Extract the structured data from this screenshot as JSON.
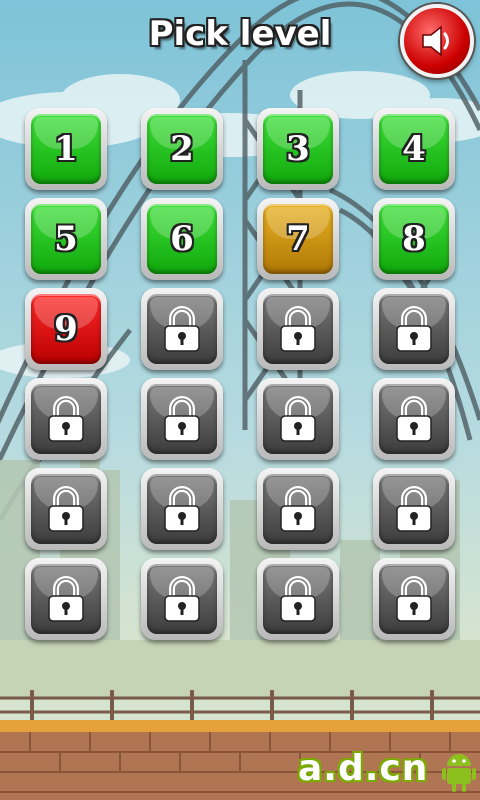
{
  "header": {
    "title": "Pick level"
  },
  "sound": {
    "icon": "speaker-icon"
  },
  "levels": [
    {
      "label": "1",
      "state": "unlocked"
    },
    {
      "label": "2",
      "state": "unlocked"
    },
    {
      "label": "3",
      "state": "unlocked"
    },
    {
      "label": "4",
      "state": "unlocked"
    },
    {
      "label": "5",
      "state": "unlocked"
    },
    {
      "label": "6",
      "state": "unlocked"
    },
    {
      "label": "7",
      "state": "partial"
    },
    {
      "label": "8",
      "state": "unlocked"
    },
    {
      "label": "9",
      "state": "current"
    },
    {
      "label": "",
      "state": "locked"
    },
    {
      "label": "",
      "state": "locked"
    },
    {
      "label": "",
      "state": "locked"
    },
    {
      "label": "",
      "state": "locked"
    },
    {
      "label": "",
      "state": "locked"
    },
    {
      "label": "",
      "state": "locked"
    },
    {
      "label": "",
      "state": "locked"
    },
    {
      "label": "",
      "state": "locked"
    },
    {
      "label": "",
      "state": "locked"
    },
    {
      "label": "",
      "state": "locked"
    },
    {
      "label": "",
      "state": "locked"
    },
    {
      "label": "",
      "state": "locked"
    },
    {
      "label": "",
      "state": "locked"
    },
    {
      "label": "",
      "state": "locked"
    },
    {
      "label": "",
      "state": "locked"
    }
  ],
  "colors": {
    "unlocked": "#22c41c",
    "partial": "#d69a12",
    "current": "#e00c0c",
    "locked": "#555555"
  },
  "watermark": {
    "text": "a.d.cn"
  }
}
